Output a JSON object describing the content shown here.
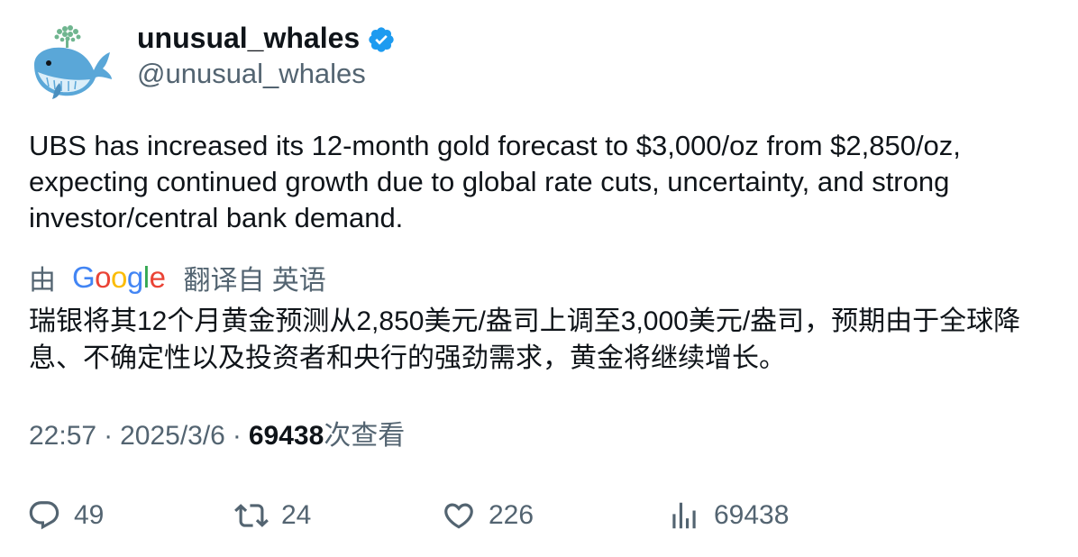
{
  "author": {
    "display_name": "unusual_whales",
    "handle": "@unusual_whales",
    "verified": true,
    "avatar_icon": "whale-logo-icon"
  },
  "tweet": {
    "text": "UBS has increased its 12-month gold forecast to $3,000/oz from $2,850/oz, expecting continued growth due to global rate cuts, uncertainty, and strong investor/central bank demand."
  },
  "translation": {
    "by_label": "由",
    "provider": "Google",
    "from_label": "翻译自 英语",
    "text": "瑞银将其12个月黄金预测从2,850美元/盎司上调至3,000美元/盎司，预期由于全球降息、不确定性以及投资者和央行的强劲需求，黄金将继续增长。"
  },
  "meta": {
    "time": "22:57",
    "separator": "·",
    "date": "2025/3/6",
    "views_count": "69438",
    "views_label": "次查看"
  },
  "actions": {
    "replies": "49",
    "retweets": "24",
    "likes": "226",
    "views": "69438"
  },
  "colors": {
    "text_primary": "#0f1419",
    "text_secondary": "#536471",
    "verified_blue": "#1d9bf0",
    "google_blue": "#4285F4",
    "google_red": "#EA4335",
    "google_yellow": "#FBBC05",
    "google_green": "#34A853"
  }
}
